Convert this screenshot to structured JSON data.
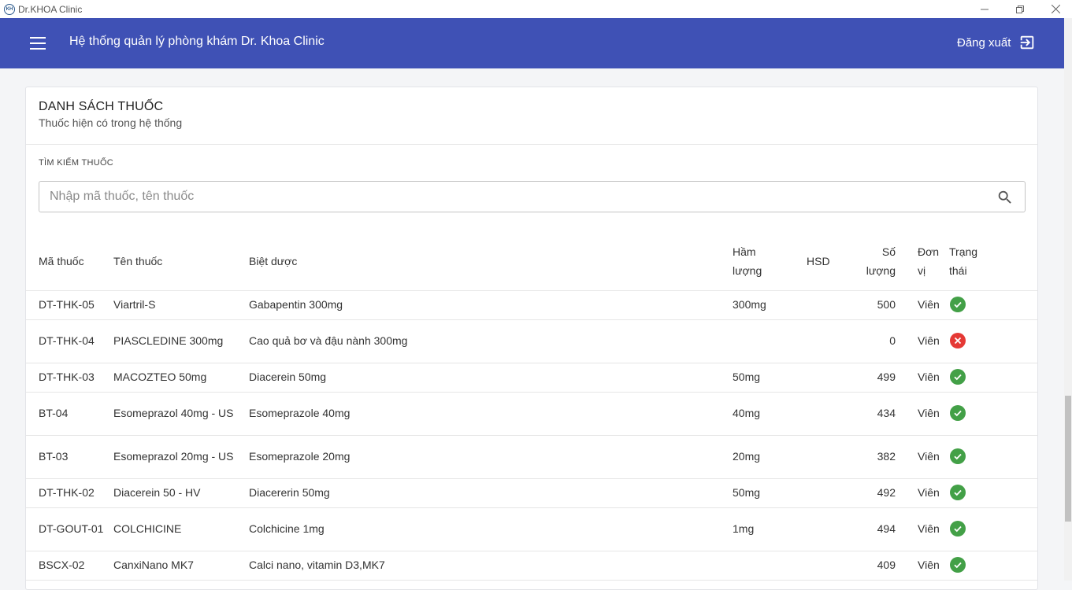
{
  "window": {
    "title": "Dr.KHOA Clinic",
    "logo_text": "KH",
    "minimize_icon": "minimize-icon",
    "maximize_icon": "restore-icon",
    "close_icon": "close-icon"
  },
  "appbar": {
    "title": "Hệ thống quản lý phòng khám Dr. Khoa Clinic",
    "logout_label": "Đăng xuất",
    "menu_icon": "menu-icon",
    "logout_icon": "logout-icon",
    "color": "#3f51b5"
  },
  "card": {
    "title": "DANH SÁCH THUỐC",
    "subtitle": "Thuốc hiện có trong hệ thống"
  },
  "search": {
    "label": "TÌM KIẾM THUỐC",
    "placeholder": "Nhập mã thuốc, tên thuốc",
    "value": ""
  },
  "table": {
    "headers": {
      "code": "Mã thuốc",
      "name": "Tên thuốc",
      "brand": "Biệt dược",
      "strength_1": "Hầm",
      "strength_2": "lượng",
      "hsd": "HSD",
      "qty_1": "Số",
      "qty_2": "lượng",
      "unit_1": "Đơn",
      "unit_2": "vị",
      "status_1": "Trạng",
      "status_2": "thái"
    },
    "rows": [
      {
        "code": "DT-THK-05",
        "name": "Viartril-S",
        "brand": "Gabapentin 300mg",
        "strength": "300mg",
        "hsd": "",
        "qty": "500",
        "unit": "Viên",
        "status": "ok"
      },
      {
        "code": "DT-THK-04",
        "name": "PIASCLEDINE 300mg",
        "brand": "Cao quả bơ và đậu nành 300mg",
        "strength": "",
        "hsd": "",
        "qty": "0",
        "unit": "Viên",
        "status": "error"
      },
      {
        "code": "DT-THK-03",
        "name": "MACOZTEO 50mg",
        "brand": "Diacerein 50mg",
        "strength": "50mg",
        "hsd": "",
        "qty": "499",
        "unit": "Viên",
        "status": "ok"
      },
      {
        "code": "BT-04",
        "name": "Esomeprazol 40mg - US",
        "brand": "Esomeprazole 40mg",
        "strength": "40mg",
        "hsd": "",
        "qty": "434",
        "unit": "Viên",
        "status": "ok"
      },
      {
        "code": "BT-03",
        "name": "Esomeprazol 20mg - US",
        "brand": "Esomeprazole 20mg",
        "strength": "20mg",
        "hsd": "",
        "qty": "382",
        "unit": "Viên",
        "status": "ok"
      },
      {
        "code": "DT-THK-02",
        "name": "Diacerein 50 - HV",
        "brand": "Diacererin 50mg",
        "strength": "50mg",
        "hsd": "",
        "qty": "492",
        "unit": "Viên",
        "status": "ok"
      },
      {
        "code": "DT-GOUT-01",
        "name": "COLCHICINE",
        "brand": "Colchicine 1mg",
        "strength": "1mg",
        "hsd": "",
        "qty": "494",
        "unit": "Viên",
        "status": "ok"
      },
      {
        "code": "BSCX-02",
        "name": "CanxiNano MK7",
        "brand": "Calci nano, vitamin D3,MK7",
        "strength": "",
        "hsd": "",
        "qty": "409",
        "unit": "Viên",
        "status": "ok"
      }
    ]
  },
  "colors": {
    "status_ok": "#43a047",
    "status_error": "#e53935"
  }
}
